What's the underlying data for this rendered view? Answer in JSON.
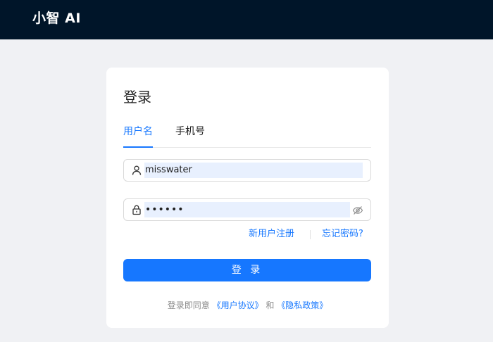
{
  "header": {
    "brand": "小智 AI"
  },
  "login": {
    "title": "登录",
    "tabs": [
      {
        "label": "用户名",
        "active": true
      },
      {
        "label": "手机号",
        "active": false
      }
    ],
    "username": {
      "value": "misswater",
      "icon": "user-icon"
    },
    "password": {
      "value": "••••••",
      "icon": "lock-icon",
      "toggle_icon": "eye-invisible-icon"
    },
    "register_link": "新用户注册",
    "forgot_link": "忘记密码?",
    "submit_label": "登 录",
    "agreement": {
      "prefix": "登录即同意 ",
      "terms": "《用户协议》",
      "and": " 和 ",
      "privacy": "《隐私政策》"
    }
  },
  "colors": {
    "header_bg": "#001529",
    "page_bg": "#f0f1f4",
    "accent": "#1677ff",
    "autofill_bg": "#e8f0fe"
  }
}
